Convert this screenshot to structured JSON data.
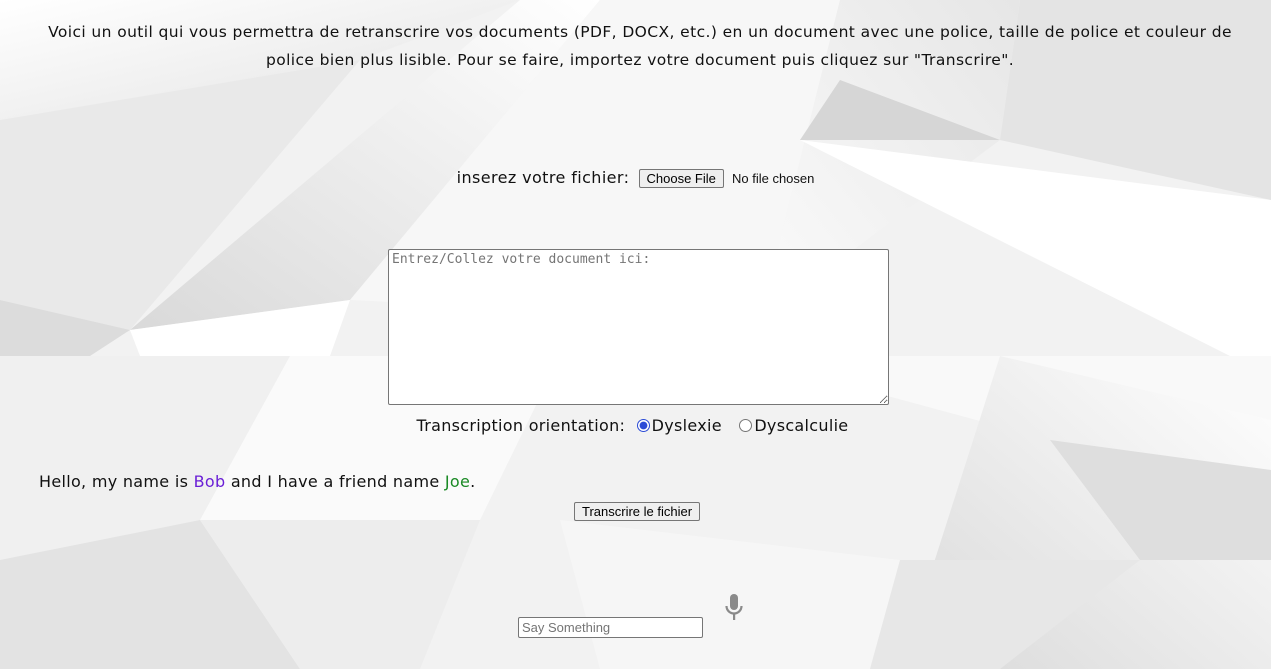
{
  "intro_text": "Voici un outil qui vous permettra de retranscrire vos documents (PDF, DOCX, etc.) en un document avec une police, taille de police et couleur de police bien plus lisible. Pour se faire, importez votre document puis cliquez sur \"Transcrire\".",
  "file_input": {
    "label": "inserez votre fichier:",
    "button_label": "Choose File",
    "status": "No file chosen"
  },
  "document_area": {
    "placeholder": "Entrez/Collez votre document ici:",
    "value": ""
  },
  "orientation": {
    "label": "Transcription orientation:",
    "options": [
      {
        "label": "Dyslexie",
        "checked": true
      },
      {
        "label": "Dyscalculie",
        "checked": false
      }
    ]
  },
  "hello": {
    "part1": "Hello, my name is ",
    "name1": "Bob",
    "part2": " and I have a friend name ",
    "name2": "Joe",
    "part3": ".",
    "name1_color": "#6a1fd6",
    "name2_color": "#1a8a25"
  },
  "transcribe_button": "Transcrire le fichier",
  "speech": {
    "placeholder": "Say Something",
    "mic_icon": "microphone-icon"
  },
  "colors": {
    "background": "#f4f4f4",
    "mic": "#8a8a8a",
    "radio_accent": "#2b4bd6"
  }
}
